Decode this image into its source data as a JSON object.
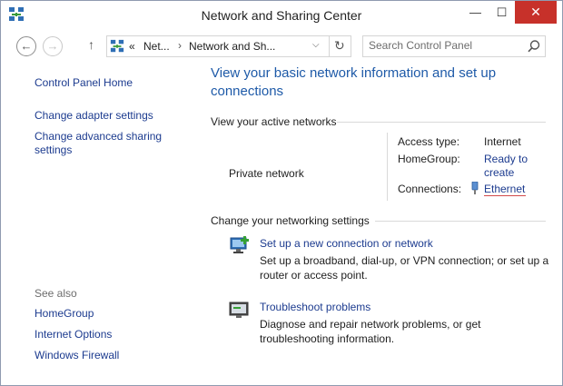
{
  "window": {
    "title": "Network and Sharing Center",
    "controls": {
      "minimize": "—",
      "maximize": "☐",
      "close": "✕"
    }
  },
  "nav": {
    "back": "←",
    "forward": "→",
    "up": "↑",
    "address": {
      "overflow": "«",
      "crumb1": "Net...",
      "crumb2": "Network and Sh...",
      "dropdown": "⌵",
      "refresh": "↻"
    },
    "search_placeholder": "Search Control Panel"
  },
  "sidebar": {
    "items": [
      {
        "label": "Control Panel Home"
      },
      {
        "label": "Change adapter settings"
      },
      {
        "label": "Change advanced sharing settings"
      }
    ],
    "see_also_label": "See also",
    "see_also": [
      {
        "label": "HomeGroup"
      },
      {
        "label": "Internet Options"
      },
      {
        "label": "Windows Firewall"
      }
    ]
  },
  "main": {
    "title": "View your basic network information and set up connections",
    "active_networks_heading": "View your active networks",
    "network_name": "Private network",
    "details": {
      "access_type_label": "Access type:",
      "access_type_value": "Internet",
      "homegroup_label": "HomeGroup:",
      "homegroup_value": "Ready to create",
      "connections_label": "Connections:",
      "connections_value": "Ethernet"
    },
    "settings_heading": "Change your networking settings",
    "tasks": [
      {
        "link": "Set up a new connection or network",
        "desc": "Set up a broadband, dial-up, or VPN connection; or set up a router or access point."
      },
      {
        "link": "Troubleshoot problems",
        "desc": "Diagnose and repair network problems, or get troubleshooting information."
      }
    ]
  },
  "colors": {
    "link": "#1c3b8f",
    "title": "#1e5aa8",
    "close": "#c7312a"
  }
}
